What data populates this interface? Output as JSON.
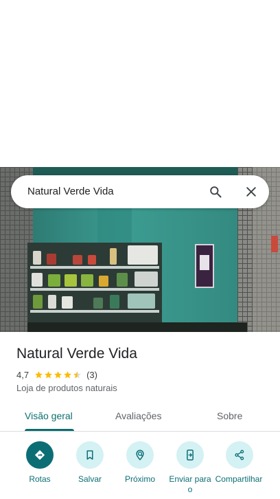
{
  "search": {
    "query": "Natural Verde Vida"
  },
  "place": {
    "name": "Natural Verde Vida",
    "rating": "4,7",
    "stars": 4.5,
    "review_count": "(3)",
    "category": "Loja de produtos naturais"
  },
  "tabs": [
    {
      "label": "Visão geral",
      "active": true
    },
    {
      "label": "Avaliações",
      "active": false
    },
    {
      "label": "Sobre",
      "active": false
    }
  ],
  "actions": [
    {
      "label": "Rotas",
      "icon": "directions-icon"
    },
    {
      "label": "Salvar",
      "icon": "bookmark-icon"
    },
    {
      "label": "Próximo",
      "icon": "nearby-icon"
    },
    {
      "label": "Enviar para o",
      "icon": "send-to-phone-icon"
    },
    {
      "label": "Compartilhar",
      "icon": "share-icon"
    }
  ],
  "colors": {
    "accent": "#0b6e75",
    "action_bg": "#d4f1f4",
    "star": "#fbbc04"
  }
}
